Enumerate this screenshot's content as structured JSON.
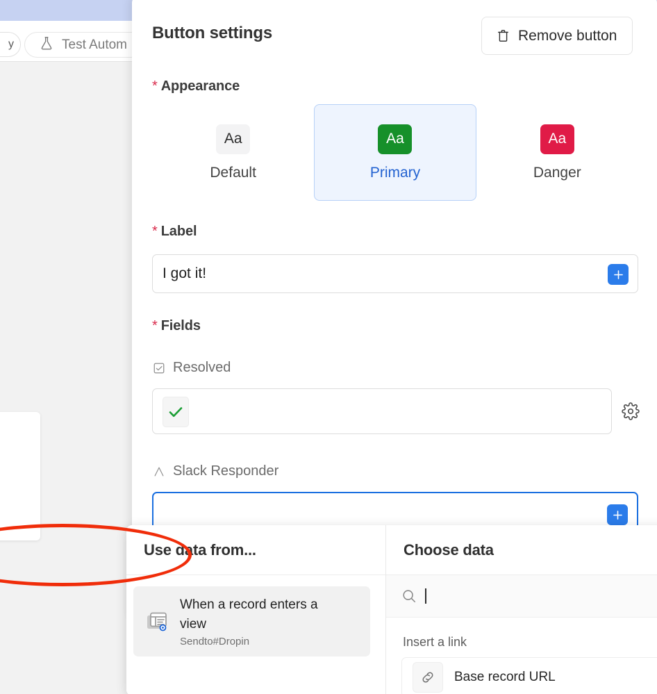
{
  "background": {
    "test_button_label": "Test Autom",
    "test_button_icon": "flask-icon"
  },
  "modal": {
    "title": "Button settings",
    "remove_button_label": "Remove button",
    "remove_button_icon": "trash-icon",
    "appearance": {
      "label": "Appearance",
      "required_marker": "*",
      "selected": "Primary",
      "options": [
        {
          "name": "Default",
          "sample": "Aa",
          "color": "#f3f3f4",
          "selected": false
        },
        {
          "name": "Primary",
          "sample": "Aa",
          "color": "#16902a",
          "selected": true
        },
        {
          "name": "Danger",
          "sample": "Aa",
          "color": "#e01b47",
          "selected": false
        }
      ]
    },
    "label_field": {
      "label": "Label",
      "required_marker": "*",
      "value": "I got it!",
      "add_icon": "plus-icon"
    },
    "fields": {
      "label": "Fields",
      "required_marker": "*",
      "items": [
        {
          "name": "Resolved",
          "type_icon": "checkbox-icon",
          "value_icon": "green-check-icon",
          "settings_icon": "gear-icon"
        },
        {
          "name": "Slack Responder",
          "type_icon": "text-field-icon",
          "value": "",
          "add_icon": "plus-icon",
          "focused": true
        }
      ]
    }
  },
  "data_picker": {
    "left_panel": {
      "title": "Use data from...",
      "items": [
        {
          "icon": "record-view-icon",
          "title": "When a record enters a view",
          "subtitle": "Sendto#Dropin"
        }
      ]
    },
    "right_panel": {
      "title": "Choose data",
      "search_placeholder": "",
      "search_value": "",
      "search_icon": "search-icon",
      "groups": [
        {
          "label": "Insert a link",
          "items": [
            {
              "icon": "link-icon",
              "label": "Base record URL"
            }
          ]
        }
      ]
    }
  },
  "annotation": {
    "shape": "ellipse",
    "color": "#f02d0a",
    "targets": "Use data from..."
  }
}
